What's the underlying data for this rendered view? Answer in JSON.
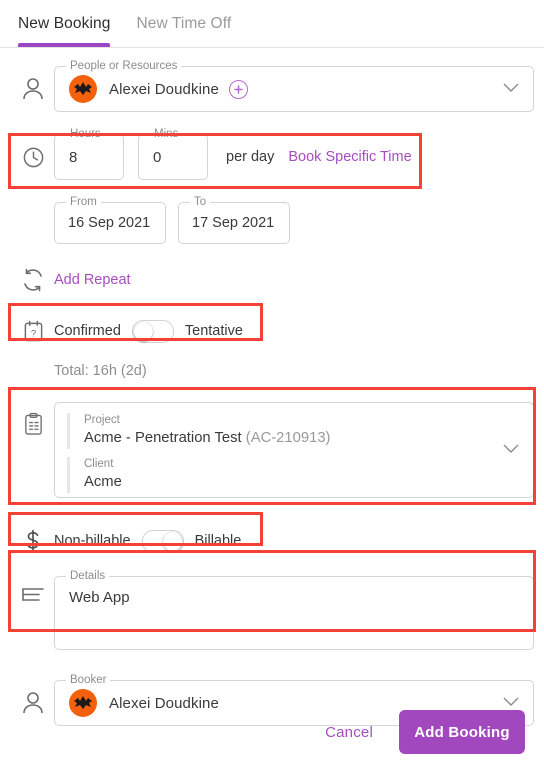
{
  "tabs": [
    {
      "label": "New Booking",
      "active": true
    },
    {
      "label": "New Time Off",
      "active": false
    }
  ],
  "people": {
    "legend": "People or Resources",
    "name": "Alexei Doudkine",
    "add_icon": "plus-circle-icon",
    "person_icon": "person-icon",
    "chevron": "chevron-down-icon"
  },
  "duration": {
    "hours_legend": "Hours",
    "hours_value": "8",
    "mins_legend": "Mins",
    "mins_value": "0",
    "per_day": "per day",
    "book_specific_time": "Book Specific Time",
    "clock_icon": "clock-icon"
  },
  "dates": {
    "from_legend": "From",
    "from_value": "16 Sep 2021",
    "to_legend": "To",
    "to_value": "17 Sep 2021"
  },
  "repeat": {
    "label": "Add Repeat",
    "icon": "repeat-icon"
  },
  "status": {
    "left_label": "Confirmed",
    "right_label": "Tentative",
    "knob_position": "left",
    "icon": "calendar-question-icon"
  },
  "total": "Total: 16h (2d)",
  "project": {
    "project_label": "Project",
    "project_value": "Acme - Penetration Test",
    "project_code": "(AC-210913)",
    "client_label": "Client",
    "client_value": "Acme",
    "icon": "clipboard-icon",
    "chevron": "chevron-down-icon"
  },
  "billable": {
    "left_label": "Non-billable",
    "right_label": "Billable",
    "knob_position": "right",
    "icon": "dollar-icon"
  },
  "details": {
    "legend": "Details",
    "value": "Web App",
    "icon": "notes-icon"
  },
  "booker": {
    "legend": "Booker",
    "name": "Alexei Doudkine",
    "person_icon": "person-icon",
    "chevron": "chevron-down-icon"
  },
  "footer": {
    "cancel_label": "Cancel",
    "submit_label": "Add Booking"
  },
  "colors": {
    "accent_purple": "#9b45c4",
    "button_purple": "#a248be",
    "link_purple": "#a64ec0",
    "highlight_red": "#f44336",
    "avatar_orange": "#f4600c"
  }
}
